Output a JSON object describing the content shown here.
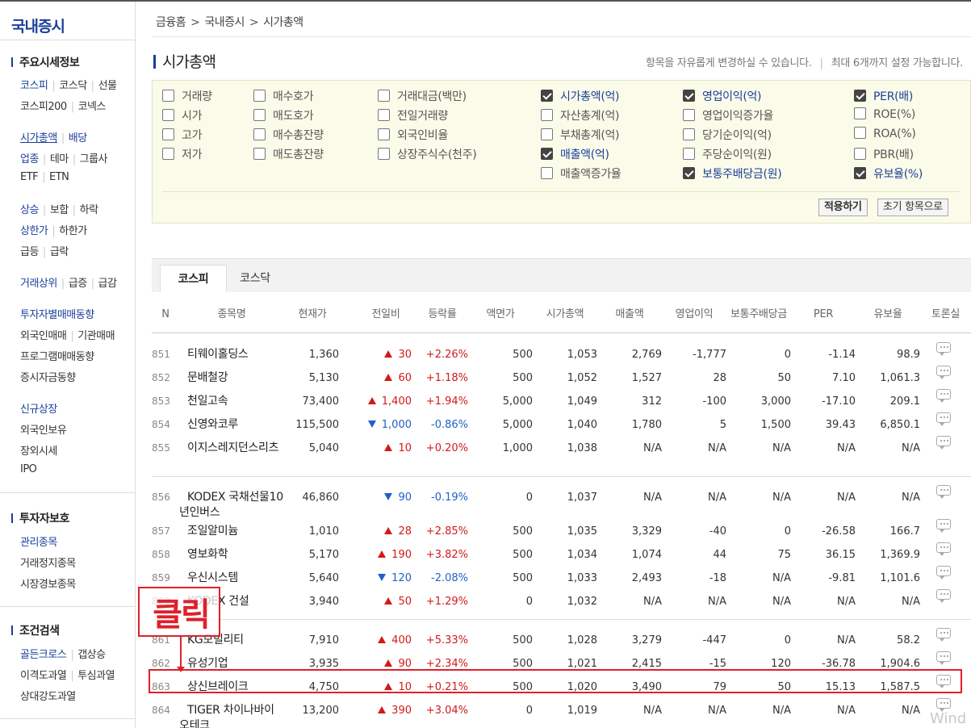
{
  "sidebar": {
    "title": "국내증시",
    "sections": [
      {
        "head": "주요시세정보",
        "rows": [
          [
            {
              "t": "코스피",
              "blue": true
            },
            {
              "t": "코스닥"
            },
            {
              "t": "선물"
            }
          ],
          [
            {
              "t": "코스피200"
            },
            {
              "t": "코넥스"
            }
          ],
          [
            {
              "t": "시가총액",
              "blue": true,
              "ul": true
            },
            {
              "t": "배당",
              "blue": true
            }
          ],
          [
            {
              "t": "업종",
              "blue": true
            },
            {
              "t": "테마"
            },
            {
              "t": "그룹사"
            }
          ],
          [
            {
              "t": "ETF"
            },
            {
              "t": "ETN"
            }
          ],
          [
            {
              "t": "상승",
              "blue": true
            },
            {
              "t": "보합"
            },
            {
              "t": "하락"
            }
          ],
          [
            {
              "t": "상한가",
              "blue": true
            },
            {
              "t": "하한가"
            }
          ],
          [
            {
              "t": "급등"
            },
            {
              "t": "급락"
            }
          ],
          [
            {
              "t": "거래상위",
              "blue": true
            },
            {
              "t": "급증"
            },
            {
              "t": "급감"
            }
          ],
          [
            {
              "t": "투자자별매매동향",
              "blue": true
            }
          ],
          [
            {
              "t": "외국인매매"
            },
            {
              "t": "기관매매"
            }
          ],
          [
            {
              "t": "프로그램매매동향"
            }
          ],
          [
            {
              "t": "증시자금동향"
            }
          ],
          [
            {
              "t": "신규상장",
              "blue": true
            }
          ],
          [
            {
              "t": "외국인보유"
            }
          ],
          [
            {
              "t": "장외시세"
            }
          ],
          [
            {
              "t": "IPO"
            }
          ]
        ]
      },
      {
        "head": "투자자보호",
        "rows": [
          [
            {
              "t": "관리종목",
              "blue": true
            }
          ],
          [
            {
              "t": "거래정지종목"
            }
          ],
          [
            {
              "t": "시장경보종목"
            }
          ]
        ]
      },
      {
        "head": "조건검색",
        "rows": [
          [
            {
              "t": "골든크로스",
              "blue": true
            },
            {
              "t": "갭상승"
            }
          ],
          [
            {
              "t": "이격도과열"
            },
            {
              "t": "투심과열"
            }
          ],
          [
            {
              "t": "상대강도과열"
            }
          ]
        ]
      }
    ]
  },
  "breadcrumb": [
    "금융홈",
    "국내증시",
    "시가총액"
  ],
  "page_title": "시가총액",
  "hint": {
    "left": "항목을 자유롭게 변경하실 수 있습니다.",
    "sep": "|",
    "right": "최대 6개까지 설정 가능합니다."
  },
  "options": [
    [
      {
        "label": "거래량",
        "checked": false
      },
      {
        "label": "시가",
        "checked": false
      },
      {
        "label": "고가",
        "checked": false
      },
      {
        "label": "저가",
        "checked": false
      }
    ],
    [
      {
        "label": "매수호가",
        "checked": false
      },
      {
        "label": "매도호가",
        "checked": false
      },
      {
        "label": "매수총잔량",
        "checked": false
      },
      {
        "label": "매도총잔량",
        "checked": false
      }
    ],
    [
      {
        "label": "거래대금(백만)",
        "checked": false
      },
      {
        "label": "전일거래량",
        "checked": false
      },
      {
        "label": "외국인비율",
        "checked": false
      },
      {
        "label": "상장주식수(천주)",
        "checked": false
      }
    ],
    [
      {
        "label": "시가총액(억)",
        "checked": true
      },
      {
        "label": "자산총계(억)",
        "checked": false
      },
      {
        "label": "부채총계(억)",
        "checked": false
      },
      {
        "label": "매출액(억)",
        "checked": true
      },
      {
        "label": "매출액증가율",
        "checked": false
      }
    ],
    [
      {
        "label": "영업이익(억)",
        "checked": true
      },
      {
        "label": "영업이익증가율",
        "checked": false
      },
      {
        "label": "당기순이익(억)",
        "checked": false
      },
      {
        "label": "주당순이익(원)",
        "checked": false
      },
      {
        "label": "보통주배당금(원)",
        "checked": true
      }
    ],
    [
      {
        "label": "PER(배)",
        "checked": true
      },
      {
        "label": "ROE(%)",
        "checked": false
      },
      {
        "label": "ROA(%)",
        "checked": false
      },
      {
        "label": "PBR(배)",
        "checked": false
      },
      {
        "label": "유보율(%)",
        "checked": true
      }
    ]
  ],
  "buttons": {
    "apply": "적용하기",
    "reset": "초기 항목으로"
  },
  "tabs": {
    "active": "코스피",
    "other": "코스닥"
  },
  "columns": [
    "N",
    "종목명",
    "현재가",
    "전일비",
    "등락률",
    "액면가",
    "시가총액",
    "매출액",
    "영업이익",
    "보통주배당금",
    "PER",
    "유보율",
    "토론실"
  ],
  "rows": [
    {
      "no": "851",
      "name": "티웨이홀딩스",
      "price": "1,360",
      "dir": "up",
      "change": "30",
      "rate": "+2.26%",
      "face": "500",
      "cap": "1,053",
      "sales": "2,769",
      "op": "-1,777",
      "div": "0",
      "per": "-1.14",
      "ret": "98.9"
    },
    {
      "no": "852",
      "name": "문배철강",
      "price": "5,130",
      "dir": "up",
      "change": "60",
      "rate": "+1.18%",
      "face": "500",
      "cap": "1,052",
      "sales": "1,527",
      "op": "28",
      "div": "50",
      "per": "7.10",
      "ret": "1,061.3"
    },
    {
      "no": "853",
      "name": "천일고속",
      "price": "73,400",
      "dir": "up",
      "change": "1,400",
      "rate": "+1.94%",
      "face": "5,000",
      "cap": "1,049",
      "sales": "312",
      "op": "-100",
      "div": "3,000",
      "per": "-17.10",
      "ret": "209.1"
    },
    {
      "no": "854",
      "name": "신영와코루",
      "price": "115,500",
      "dir": "down",
      "change": "1,000",
      "rate": "-0.86%",
      "face": "5,000",
      "cap": "1,040",
      "sales": "1,780",
      "op": "5",
      "div": "1,500",
      "per": "39.43",
      "ret": "6,850.1"
    },
    {
      "no": "855",
      "name": "이지스레지던스리츠",
      "price": "5,040",
      "dir": "up",
      "change": "10",
      "rate": "+0.20%",
      "face": "1,000",
      "cap": "1,038",
      "sales": "N/A",
      "op": "N/A",
      "div": "N/A",
      "per": "N/A",
      "ret": "N/A"
    },
    {
      "no": "856",
      "name": "KODEX 국채선물10년인버스",
      "price": "46,860",
      "dir": "down",
      "change": "90",
      "rate": "-0.19%",
      "face": "0",
      "cap": "1,037",
      "sales": "N/A",
      "op": "N/A",
      "div": "N/A",
      "per": "N/A",
      "ret": "N/A"
    },
    {
      "no": "857",
      "name": "조일알미늄",
      "price": "1,010",
      "dir": "up",
      "change": "28",
      "rate": "+2.85%",
      "face": "500",
      "cap": "1,035",
      "sales": "3,329",
      "op": "-40",
      "div": "0",
      "per": "-26.58",
      "ret": "166.7"
    },
    {
      "no": "858",
      "name": "영보화학",
      "price": "5,170",
      "dir": "up",
      "change": "190",
      "rate": "+3.82%",
      "face": "500",
      "cap": "1,034",
      "sales": "1,074",
      "op": "44",
      "div": "75",
      "per": "36.15",
      "ret": "1,369.9"
    },
    {
      "no": "859",
      "name": "우신시스템",
      "price": "5,640",
      "dir": "down",
      "change": "120",
      "rate": "-2.08%",
      "face": "500",
      "cap": "1,033",
      "sales": "2,493",
      "op": "-18",
      "div": "N/A",
      "per": "-9.81",
      "ret": "1,101.6"
    },
    {
      "no": "860",
      "name": "KODEX 건설",
      "price": "3,940",
      "dir": "up",
      "change": "50",
      "rate": "+1.29%",
      "face": "0",
      "cap": "1,032",
      "sales": "N/A",
      "op": "N/A",
      "div": "N/A",
      "per": "N/A",
      "ret": "N/A"
    },
    {
      "no": "861",
      "name": "KG모빌리티",
      "price": "7,910",
      "dir": "up",
      "change": "400",
      "rate": "+5.33%",
      "face": "500",
      "cap": "1,028",
      "sales": "3,279",
      "op": "-447",
      "div": "0",
      "per": "N/A",
      "ret": "58.2"
    },
    {
      "no": "862",
      "name": "유성기업",
      "price": "3,935",
      "dir": "up",
      "change": "90",
      "rate": "+2.34%",
      "face": "500",
      "cap": "1,021",
      "sales": "2,415",
      "op": "-15",
      "div": "120",
      "per": "-36.78",
      "ret": "1,904.6"
    },
    {
      "no": "863",
      "name": "상신브레이크",
      "price": "4,750",
      "dir": "up",
      "change": "10",
      "rate": "+0.21%",
      "face": "500",
      "cap": "1,020",
      "sales": "3,490",
      "op": "79",
      "div": "50",
      "per": "15.13",
      "ret": "1,587.5"
    },
    {
      "no": "864",
      "name": "TIGER 차이나바이오테크",
      "price": "13,200",
      "dir": "up",
      "change": "390",
      "rate": "+3.04%",
      "face": "0",
      "cap": "1,019",
      "sales": "N/A",
      "op": "N/A",
      "div": "N/A",
      "per": "N/A",
      "ret": "N/A"
    }
  ],
  "annotation": {
    "label": "클릭"
  },
  "watermark": "Wind",
  "colors": {
    "accent": "#1a3f9a",
    "up": "#d21a1a",
    "down": "#1f60c8",
    "highlight": "#e0202a",
    "options_bg": "#fbfbe9"
  }
}
